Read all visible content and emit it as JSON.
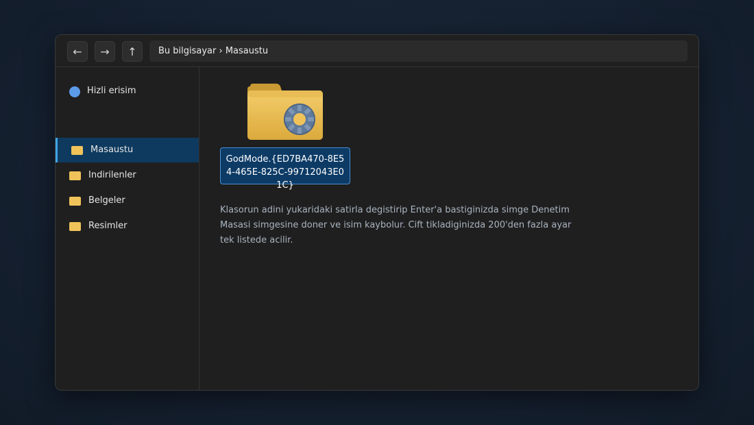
{
  "toolbar": {
    "back_icon": "←",
    "forward_icon": "→",
    "up_icon": "↑",
    "breadcrumb": "Bu bilgisayar › Masaustu"
  },
  "sidebar": {
    "items": [
      {
        "label": "Hizli erisim",
        "icon": "quick-access-icon"
      },
      {
        "label": "Masaustu",
        "icon": "folder-icon"
      },
      {
        "label": "Indirilenler",
        "icon": "folder-icon"
      },
      {
        "label": "Belgeler",
        "icon": "folder-icon"
      },
      {
        "label": "Resimler",
        "icon": "folder-icon"
      }
    ]
  },
  "main": {
    "folder_name": "GodMode.{ED7BA470-8E54-465E-825C-99712043E01C}",
    "folder_icon": "control-panel-folder-icon",
    "description": "Klasorun adini yukaridaki satirla degistirip Enter'a bastiginizda simge Denetim Masasi simgesine doner ve isim kaybolur. Cift tikladiginizda 200'den fazla ayar tek listede acilir."
  },
  "colors": {
    "accent": "#3fa5e8",
    "selection": "#0e3a5f",
    "folder": "#f0c35a"
  }
}
